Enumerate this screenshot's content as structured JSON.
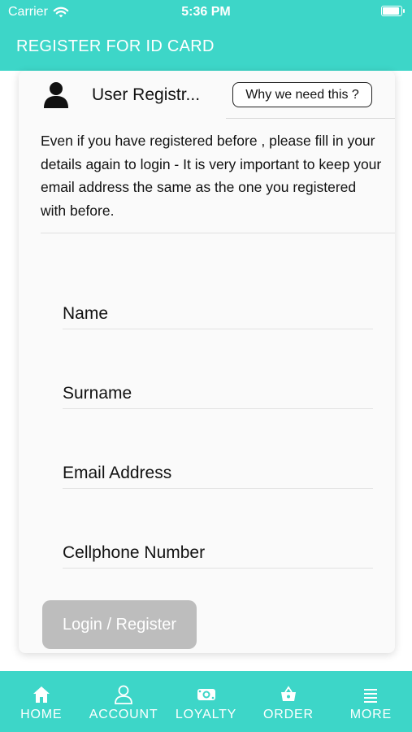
{
  "status_bar": {
    "carrier": "Carrier",
    "time": "5:36 PM"
  },
  "header": {
    "title": "REGISTER FOR ID CARD"
  },
  "card": {
    "title": "User Registr...",
    "why_button": "Why we need this ?",
    "notice": "Even if you have registered before , please fill in your details again to login - It is very important to keep your email address the same as the one you registered with before."
  },
  "form": {
    "name_placeholder": "Name",
    "surname_placeholder": "Surname",
    "email_placeholder": "Email Address",
    "cell_placeholder": "Cellphone Number",
    "submit_label": "Login / Register"
  },
  "tabs": [
    {
      "label": "HOME",
      "icon": "home-icon"
    },
    {
      "label": "ACCOUNT",
      "icon": "account-icon"
    },
    {
      "label": "LOYALTY",
      "icon": "loyalty-icon"
    },
    {
      "label": "ORDER",
      "icon": "basket-icon"
    },
    {
      "label": "MORE",
      "icon": "menu-icon"
    }
  ],
  "colors": {
    "accent": "#3dd6c8",
    "button_disabled": "#bdbdbd"
  }
}
